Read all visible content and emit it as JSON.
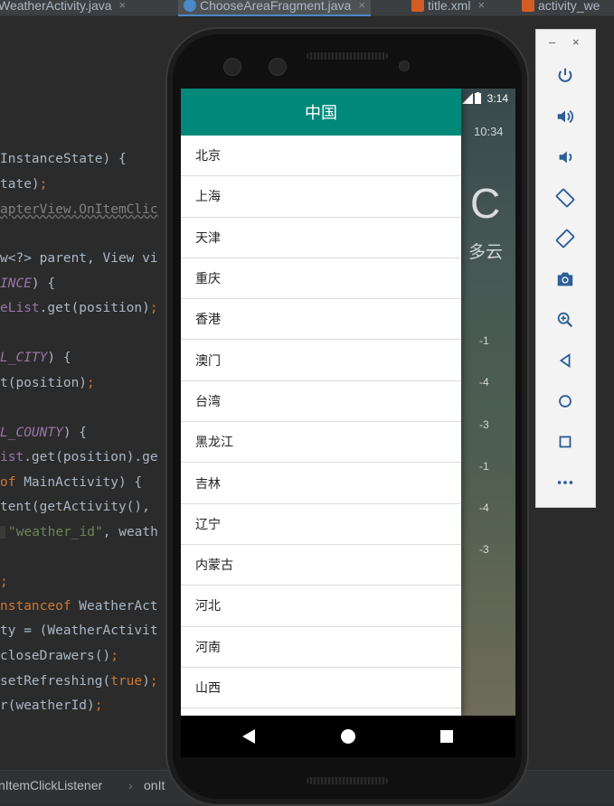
{
  "tabs": [
    {
      "label": "WeatherActivity.java",
      "close": "×"
    },
    {
      "label": "ChooseAreaFragment.java",
      "close": "×"
    },
    {
      "label": "title.xml",
      "close": "×"
    },
    {
      "label": "activity_we",
      "close": ""
    }
  ],
  "code": {
    "l1a": "InstanceState) {",
    "l2a": "tate)",
    "l2b": ";",
    "l3a": "apterView.OnItemClic",
    "l4a": "w<?> parent, View vi",
    "l5a": "INCE",
    "l5b": ") {",
    "l6a": "eList",
    "l6b": ".get(position)",
    "l6c": ";",
    "l7a": "L_CITY",
    "l7b": ") {",
    "l8a": "t(position)",
    "l8b": ";",
    "l9a": "L_COUNTY",
    "l9b": ") {",
    "l10a": "ist",
    "l10b": ".get(position).ge",
    "l11a": "of",
    "l11b": " MainActivity) {",
    "l12a": "tent(getActivity(), ",
    "l13a": "\"weather_id\"",
    "l13b": ", weath",
    "l14a": ";",
    "l15a": "nstanceof",
    "l15b": " WeatherAct",
    "l16a": "ty = (WeatherActivit",
    "l17a": "closeDrawers()",
    "l17b": ";",
    "l18a": "setRefreshing(",
    "l18b": "true",
    "l18c": ")",
    "l18d": ";",
    "l19a": "r(weatherId)",
    "l19b": ";"
  },
  "breadcrumb": {
    "item1": "nItemClickListener",
    "sep": "›",
    "item2": "onIt"
  },
  "phone": {
    "clock": "3:14",
    "drawer_title": "中国",
    "provinces": [
      "北京",
      "上海",
      "天津",
      "重庆",
      "香港",
      "澳门",
      "台湾",
      "黑龙江",
      "吉林",
      "辽宁",
      "内蒙古",
      "河北",
      "河南",
      "山西"
    ],
    "bg": {
      "time": "10:34",
      "temp_glyph": "C",
      "weather": "多云",
      "forecast": [
        "-1",
        "-4",
        "-3",
        "-1",
        "-4",
        "-3"
      ]
    }
  },
  "panel": {
    "minimize": "–",
    "close": "×",
    "buttons": [
      "power-icon",
      "volume-up-icon",
      "volume-down-icon",
      "rotate-left-icon",
      "rotate-right-icon",
      "camera-icon",
      "zoom-icon",
      "back-icon",
      "home-icon",
      "overview-icon",
      "more-icon"
    ]
  },
  "colors": {
    "accent": "#00897b",
    "panel_icon": "#2c5f96"
  }
}
